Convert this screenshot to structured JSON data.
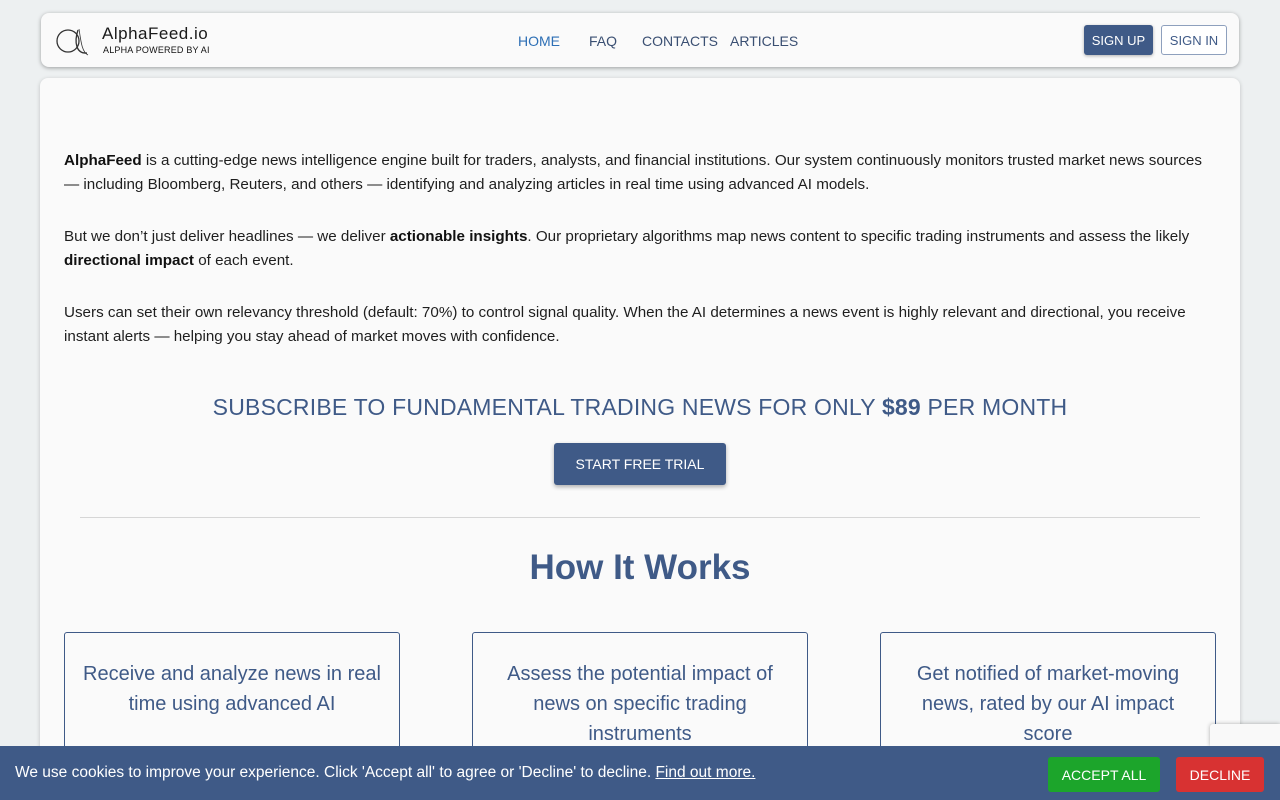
{
  "header": {
    "logo_glyph": "α",
    "logo_name": "AlphaFeed.io",
    "logo_tagline": "ALPHA POWERED BY AI",
    "nav": [
      {
        "label": "HOME",
        "active": true
      },
      {
        "label": "FAQ",
        "active": false
      },
      {
        "label": "CONTACTS",
        "active": false
      },
      {
        "label": "ARTICLES",
        "active": false
      }
    ],
    "signup_label": "SIGN UP",
    "signin_label": "SIGN IN"
  },
  "main": {
    "p1": {
      "brand": "AlphaFeed",
      "text": " is a cutting-edge news intelligence engine built for traders, analysts, and financial institutions. Our system continuously monitors trusted market news sources — including Bloomberg, Reuters, and others — identifying and analyzing articles in real time using advanced AI models."
    },
    "p2": {
      "t1": "But we don’t just deliver headlines — we deliver ",
      "b1": "actionable insights",
      "t2": ". Our proprietary algorithms map news content to specific trading instruments and assess the likely ",
      "b2": "directional impact",
      "t3": " of each event."
    },
    "p3": "Users can set their own relevancy threshold (default: 70%) to control signal quality. When the AI determines a news event is highly relevant and directional, you receive instant alerts — helping you stay ahead of market moves with confidence.",
    "subscribe": {
      "prefix": "SUBSCRIBE TO FUNDAMENTAL TRADING NEWS FOR ONLY ",
      "price": "$89",
      "suffix": " PER MONTH"
    },
    "trial_label": "START FREE TRIAL",
    "how_title": "How It Works",
    "cards": [
      "Receive and analyze news in real time using advanced AI",
      "Assess the potential impact of news on specific trading instruments",
      "Get notified of market-moving news, rated by our AI impact score"
    ]
  },
  "cookie": {
    "text": "We use cookies to improve your experience. Click 'Accept all' to agree or 'Decline' to decline. ",
    "link": "Find out more.",
    "accept_label": "ACCEPT ALL",
    "decline_label": "DECLINE"
  },
  "colors": {
    "brand": "#3f5a87",
    "nav_active": "#2d6fb5",
    "accept": "#1ca52b",
    "decline": "#d83232"
  }
}
